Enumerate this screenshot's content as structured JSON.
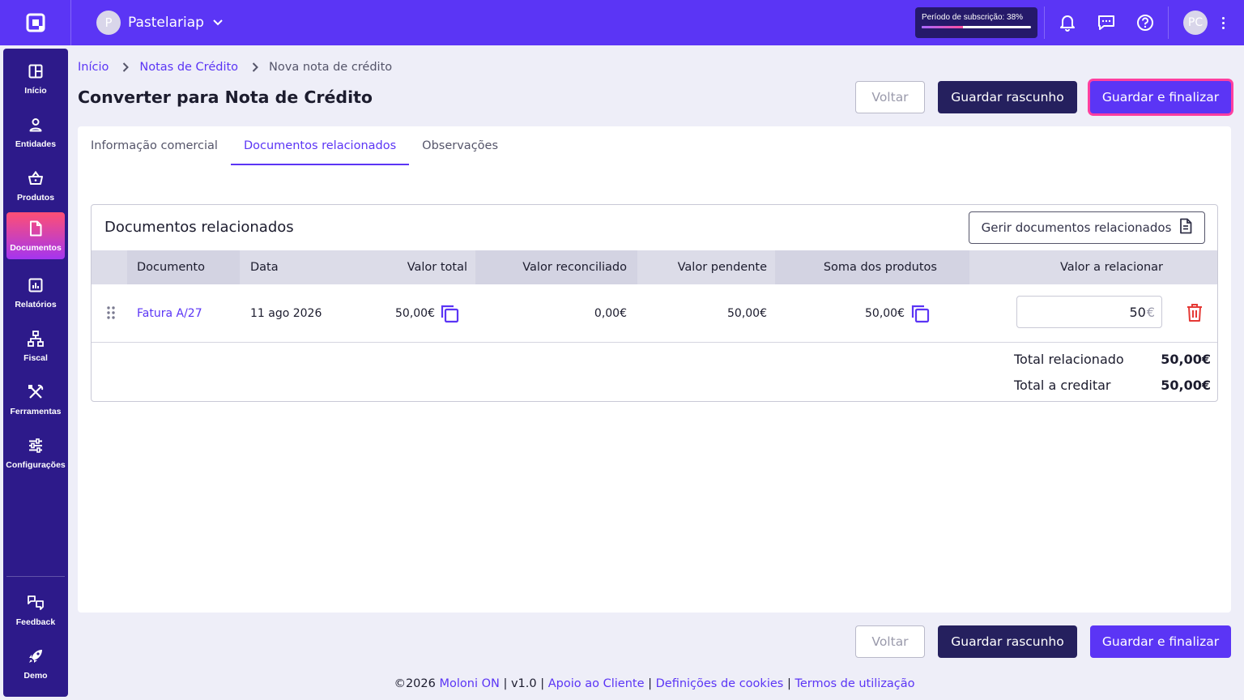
{
  "topbar": {
    "company_initial": "P",
    "company_name": "Pastelariap",
    "subscription_label": "Período de subscrição: 38%",
    "subscription_progress": 0.38,
    "user_initials": "PC",
    "icons": [
      "moloni-logo-icon",
      "chevron-down-icon",
      "bell-icon",
      "chat-icon",
      "help-icon",
      "kebab-menu-icon"
    ]
  },
  "sidebar": {
    "items": [
      {
        "label": "Início",
        "icon": "dashboard-icon"
      },
      {
        "label": "Entidades",
        "icon": "user-icon"
      },
      {
        "label": "Produtos",
        "icon": "basket-icon"
      },
      {
        "label": "Documentos",
        "icon": "document-icon",
        "active": true
      },
      {
        "label": "Relatórios",
        "icon": "report-chart-icon"
      },
      {
        "label": "Fiscal",
        "icon": "fiscal-network-icon"
      },
      {
        "label": "Ferramentas",
        "icon": "tools-icon"
      },
      {
        "label": "Configurações",
        "icon": "sliders-icon"
      }
    ],
    "bottom": [
      {
        "label": "Feedback",
        "icon": "feedback-icon"
      },
      {
        "label": "Demo",
        "icon": "rocket-icon"
      }
    ]
  },
  "breadcrumb": {
    "items": [
      "Início",
      "Notas de Crédito"
    ],
    "current": "Nova nota de crédito"
  },
  "page": {
    "title": "Converter para Nota de Crédito",
    "back_label": "Voltar",
    "draft_label": "Guardar rascunho",
    "finalize_label": "Guardar e finalizar"
  },
  "tabs": [
    {
      "label": "Informação comercial"
    },
    {
      "label": "Documentos relacionados",
      "active": true
    },
    {
      "label": "Observações"
    }
  ],
  "related": {
    "title": "Documentos relacionados",
    "manage_label": "Gerir documentos relacionados",
    "columns": [
      "Documento",
      "Data",
      "Valor total",
      "Valor reconciliado",
      "Valor pendente",
      "Soma dos produtos",
      "Valor a relacionar"
    ],
    "rows": [
      {
        "document": "Fatura A/27",
        "date": "11 ago 2026",
        "total": "50,00€",
        "reconciled": "0,00€",
        "pending": "50,00€",
        "products_sum": "50,00€",
        "to_relate": "50",
        "currency": "€"
      }
    ],
    "totals": {
      "related_label": "Total relacionado",
      "related_value": "50,00€",
      "credit_label": "Total a creditar",
      "credit_value": "50,00€"
    }
  },
  "footer": {
    "copyright": "©2026",
    "brand": "Moloni ON",
    "version": "v1.0",
    "links": [
      "Apoio ao Cliente",
      "Definições de cookies",
      "Termos de utilização"
    ]
  },
  "colors": {
    "brand": "#5b35f5",
    "sidebar": "#2d1a8a",
    "dark_button": "#25205e",
    "danger": "#e53935",
    "focus_ring": "#ff3fa0"
  }
}
